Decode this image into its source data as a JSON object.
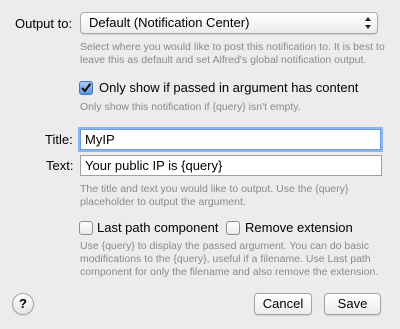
{
  "output": {
    "label": "Output to:",
    "selected": "Default (Notification Center)",
    "help": "Select where you would like to post this notification to. It is best to leave this as default and set Alfred's global notification output."
  },
  "only_show": {
    "checked": true,
    "label": "Only show if passed in argument has content",
    "help": "Only show this notification if {query} isn't empty."
  },
  "title": {
    "label": "Title:",
    "value": "MyIP"
  },
  "text": {
    "label": "Text:",
    "value": "Your public IP is {query}",
    "help": "The title and text you would like to output. Use the {query} placeholder to output the argument."
  },
  "options": {
    "last_path": {
      "checked": false,
      "label": "Last path component"
    },
    "remove_ext": {
      "checked": false,
      "label": "Remove extension"
    },
    "help": "Use {query} to display the passed argument. You can do basic modifications to the {query}, useful if a filename. Use Last path component for only the filename and also remove the extension."
  },
  "buttons": {
    "help_glyph": "?",
    "cancel": "Cancel",
    "save": "Save"
  },
  "colors": {
    "focus_ring": "#8db6ef",
    "checkbox_checked": "#5a93df"
  }
}
